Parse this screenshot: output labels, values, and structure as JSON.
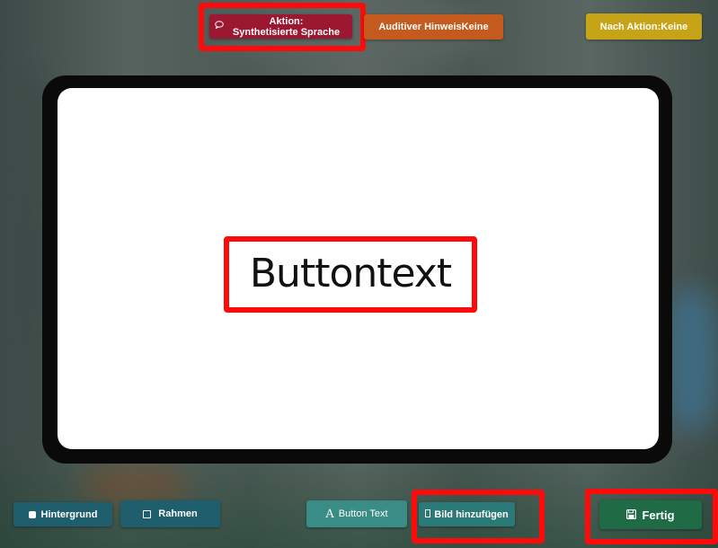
{
  "top_bar": {
    "aktion_label_line1": "Aktion:",
    "aktion_label_line2": "Synthetisierte Sprache",
    "auditiv_label": "Auditiver HinweisKeine",
    "nach_aktion_label": "Nach Aktion:Keine"
  },
  "card": {
    "button_text": "Buttontext"
  },
  "bottom_bar": {
    "hintergrund_label": "Hintergrund",
    "rahmen_label": "Rahmen",
    "button_text_label": "Button Text",
    "bild_label": "Bild hinzufügen",
    "fertig_label": "Fertig"
  },
  "colors": {
    "aktion": "#9c1730",
    "auditiv": "#c45a1d",
    "nach_aktion": "#c7a318",
    "teal": "#1f5f6d",
    "fertig": "#1f6b45",
    "highlight": "#ff0a0a"
  },
  "icons": {
    "aktion": "speech-bubble-icon",
    "hintergrund": "filled-square-icon",
    "rahmen": "outline-square-icon",
    "button_text": "font-letter-icon",
    "bild": "image-icon",
    "fertig": "save-icon"
  }
}
